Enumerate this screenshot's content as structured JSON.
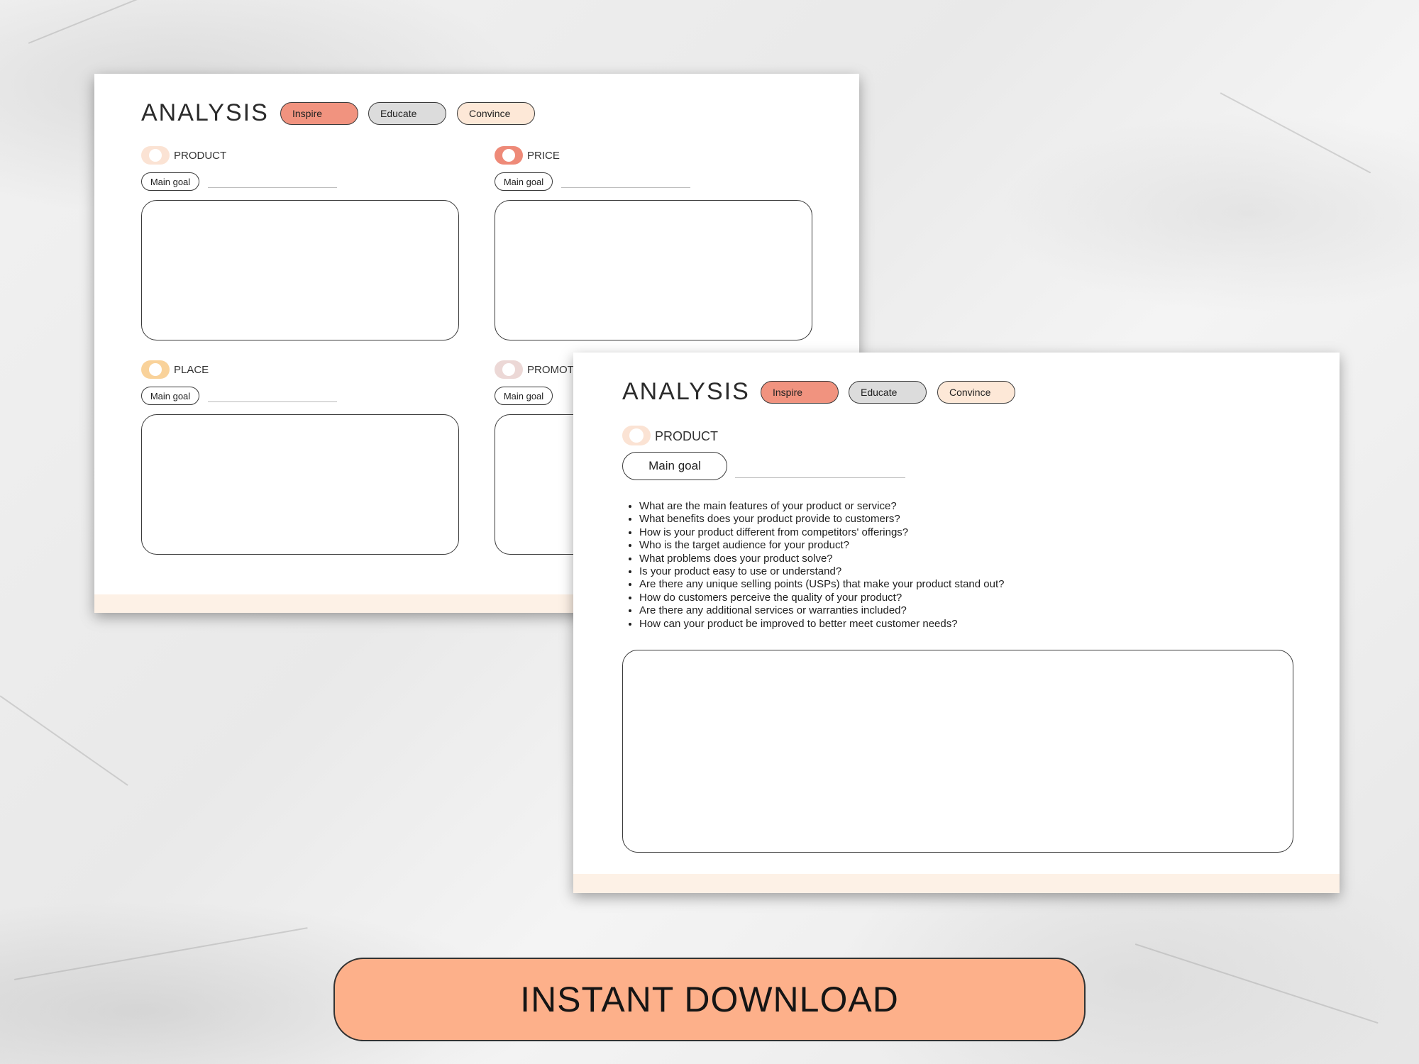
{
  "colors": {
    "inspire": "#f1937f",
    "educate": "#dcdcdc",
    "convince": "#fde8d7",
    "toggle_product": "#fbe3d4",
    "toggle_price": "#ee8a78",
    "toggle_place": "#f9d29a",
    "toggle_promotion": "#ecd8d6",
    "cta_background": "#fdb08a"
  },
  "back_sheet": {
    "title": "ANALYSIS",
    "tags": [
      "Inspire",
      "Educate",
      "Convince"
    ],
    "sections": [
      {
        "label": "PRODUCT",
        "goal_label": "Main goal"
      },
      {
        "label": "PRICE",
        "goal_label": "Main goal"
      },
      {
        "label": "PLACE",
        "goal_label": "Main goal"
      },
      {
        "label": "PROMOT",
        "goal_label": "Main goal"
      }
    ]
  },
  "front_sheet": {
    "title": "ANALYSIS",
    "tags": [
      "Inspire",
      "Educate",
      "Convince"
    ],
    "section_label": "PRODUCT",
    "goal_label": "Main goal",
    "questions": [
      "What are the main features of your product or service?",
      "What benefits does your product provide to customers?",
      "How is your product different from competitors' offerings?",
      "Who is the target audience for your product?",
      "What problems does your product solve?",
      "Is your product easy to use or understand?",
      "Are there any unique selling points (USPs) that make your product stand out?",
      "How do customers perceive the quality of your product?",
      "Are there any additional services or warranties included?",
      "How can your product be improved to better meet customer needs?"
    ]
  },
  "cta": {
    "label": "INSTANT DOWNLOAD"
  }
}
